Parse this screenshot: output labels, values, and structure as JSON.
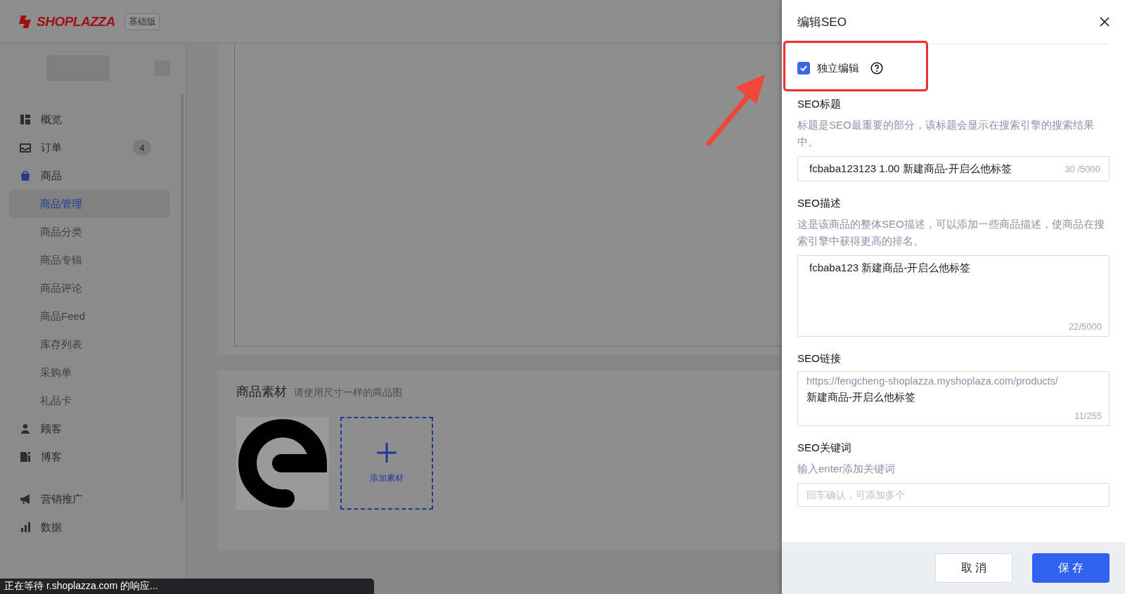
{
  "header": {
    "logo": "SHOPLAZZA",
    "plan_badge": "基础版"
  },
  "sidebar": {
    "groups": [
      {
        "items": [
          {
            "label": "概览",
            "selected": false
          },
          {
            "label": "订单",
            "selected": false,
            "badge": "4"
          },
          {
            "label": "商品",
            "selected": false,
            "children": [
              {
                "label": "商品管理",
                "selected": true
              },
              {
                "label": "商品分类",
                "selected": false
              },
              {
                "label": "商品专辑",
                "selected": false
              },
              {
                "label": "商品评论",
                "selected": false
              },
              {
                "label": "商品Feed",
                "selected": false
              },
              {
                "label": "库存列表",
                "selected": false
              },
              {
                "label": "采购单",
                "selected": false
              },
              {
                "label": "礼品卡",
                "selected": false
              }
            ]
          },
          {
            "label": "顾客",
            "selected": false
          },
          {
            "label": "博客",
            "selected": false
          }
        ]
      },
      {
        "items": [
          {
            "label": "营销推广",
            "selected": false
          },
          {
            "label": "数据",
            "selected": false
          }
        ]
      }
    ]
  },
  "media": {
    "title": "商品素材",
    "hint": "请使用尺寸一样的商品图",
    "add_label": "添加素材"
  },
  "drawer": {
    "title": "编辑SEO",
    "independent": {
      "label": "独立编辑",
      "checked": true
    },
    "fields": [
      {
        "kind": "input",
        "label": "SEO标题",
        "help": "标题是SEO最重要的部分，该标题会显示在搜索引擎的搜索结果中。",
        "value": "fcbaba123123 1.00 新建商品-开启么他标签",
        "count": "30 /5000"
      },
      {
        "kind": "textarea",
        "label": "SEO描述",
        "help": "这是该商品的整体SEO描述，可以添加一些商品描述，使商品在搜索引擎中获得更高的排名。",
        "value": "fcbaba123 新建商品-开启么他标签",
        "count": "22/5000"
      },
      {
        "kind": "url",
        "label": "SEO链接",
        "prefix": "https://fengcheng-shoplazza.myshoplaza.com/products/",
        "value": "新建商品-开启么他标签",
        "count": "11/255"
      },
      {
        "kind": "tags",
        "label": "SEO关键词",
        "help": "输入enter添加关键词",
        "placeholder": "回车确认，可添加多个"
      }
    ],
    "buttons": [
      {
        "label": "取 消",
        "kind": "default"
      },
      {
        "label": "保 存",
        "kind": "primary"
      }
    ]
  },
  "status_bar": "正在等待 r.shoplazza.com 的响应..."
}
